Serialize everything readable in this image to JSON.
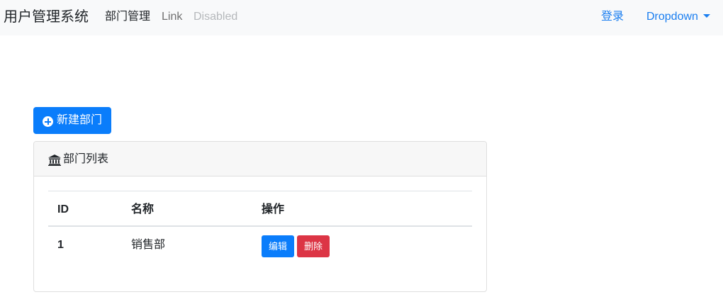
{
  "navbar": {
    "brand": "用户管理系统",
    "links": [
      {
        "label": "部门管理",
        "state": "active"
      },
      {
        "label": "Link",
        "state": "normal"
      },
      {
        "label": "Disabled",
        "state": "disabled"
      }
    ],
    "right": {
      "login": "登录",
      "dropdown": "Dropdown"
    }
  },
  "toolbar": {
    "new_button": "新建部门",
    "new_button_icon": "plus-circle-icon"
  },
  "panel": {
    "title": "部门列表",
    "title_icon": "bank-icon",
    "table": {
      "headers": [
        "ID",
        "名称",
        "操作"
      ],
      "rows": [
        {
          "id": "1",
          "name": "销售部",
          "edit_label": "编辑",
          "delete_label": "删除"
        }
      ]
    }
  },
  "colors": {
    "primary": "#0a7dfb",
    "danger": "#dc3545",
    "link": "#1a7ef0",
    "navbar_bg": "#f8f9fa"
  }
}
